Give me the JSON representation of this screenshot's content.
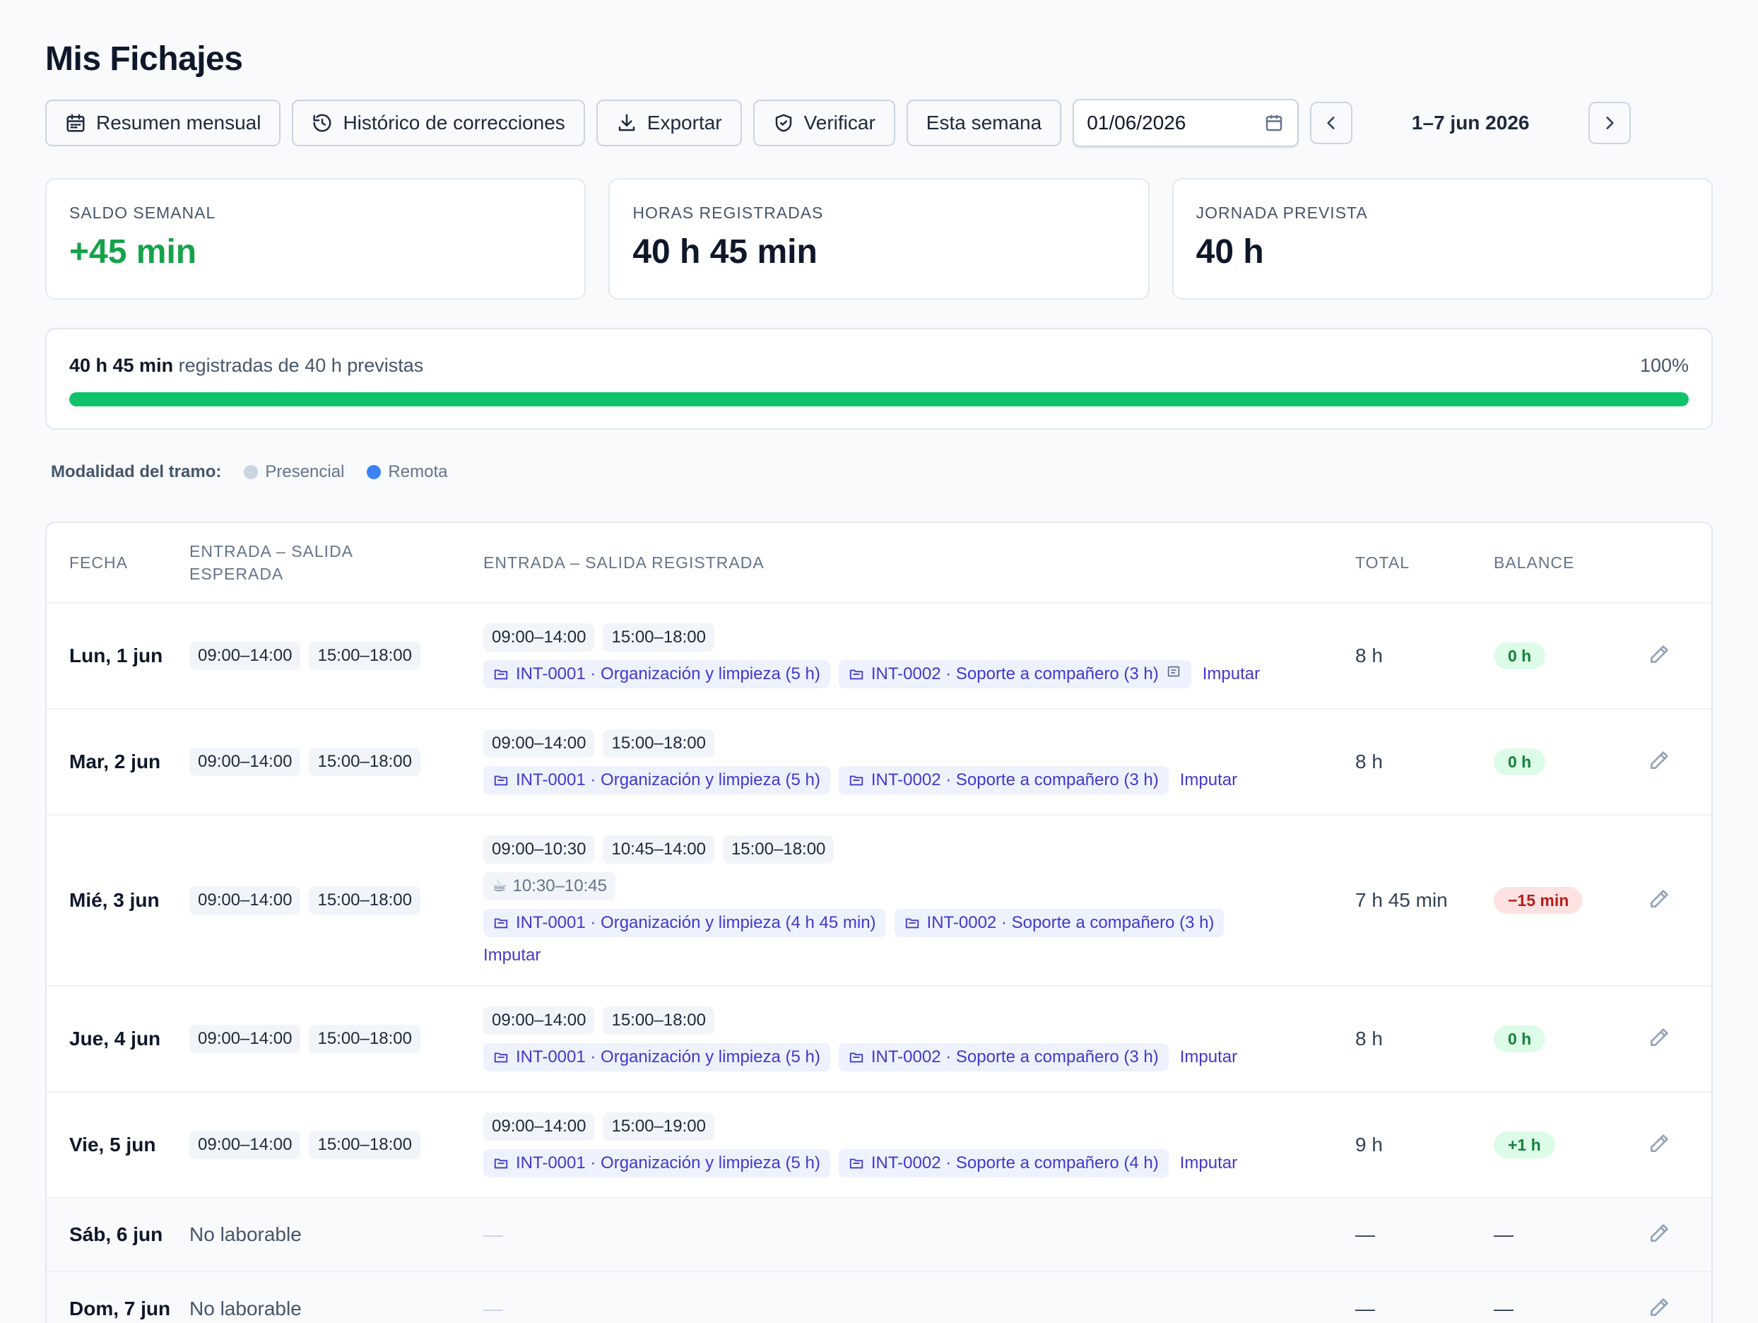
{
  "page": {
    "title": "Mis Fichajes"
  },
  "toolbar": {
    "monthly": "Resumen mensual",
    "history": "Histórico de correcciones",
    "export": "Exportar",
    "verify": "Verificar",
    "this_week": "Esta semana",
    "date_value": "01/06/2026",
    "range": "1–7 jun 2026"
  },
  "stats": [
    {
      "label": "SALDO SEMANAL",
      "value": "+45 min"
    },
    {
      "label": "HORAS REGISTRADAS",
      "value": "40 h 45 min"
    },
    {
      "label": "JORNADA PREVISTA",
      "value": "40 h"
    }
  ],
  "progress": {
    "registered": "40 h 45 min",
    "suffix": "registradas de 40 h previstas",
    "percent_label": "100%",
    "fraction": 1.0
  },
  "legend": {
    "title": "Modalidad del tramo:",
    "items": [
      {
        "label": "Presencial",
        "color": "#cbd5e1"
      },
      {
        "label": "Remota",
        "color": "#3b82f6"
      }
    ]
  },
  "table": {
    "headers": {
      "date": "FECHA",
      "expected_1": "ENTRADA – SALIDA",
      "expected_2": "ESPERADA",
      "registered": "ENTRADA – SALIDA REGISTRADA",
      "total": "TOTAL",
      "balance": "BALANCE"
    },
    "imputar": "Imputar",
    "rows": [
      {
        "date": "Lun, 1 jun",
        "expected": [
          "09:00–14:00",
          "15:00–18:00"
        ],
        "registered": [
          "09:00–14:00",
          "15:00–18:00"
        ],
        "projects": [
          "INT-0001 · Organización y limpieza (5 h)",
          "INT-0002 · Soporte a compañero (3 h)"
        ],
        "total": "8 h",
        "balance": "0 h"
      },
      {
        "date": "Mar, 2 jun",
        "expected": [
          "09:00–14:00",
          "15:00–18:00"
        ],
        "registered": [
          "09:00–14:00",
          "15:00–18:00"
        ],
        "projects": [
          "INT-0001 · Organización y limpieza (5 h)",
          "INT-0002 · Soporte a compañero (3 h)"
        ],
        "total": "8 h",
        "balance": "0 h"
      },
      {
        "date": "Mié, 3 jun",
        "expected": [
          "09:00–14:00",
          "15:00–18:00"
        ],
        "registered": [
          "09:00–10:30",
          "10:45–14:00",
          "15:00–18:00"
        ],
        "break": "10:30–10:45",
        "projects": [
          "INT-0001 · Organización y limpieza (4 h 45 min)",
          "INT-0002 · Soporte a compañero (3 h)"
        ],
        "total": "7 h 45 min",
        "balance": "−15 min"
      },
      {
        "date": "Jue, 4 jun",
        "expected": [
          "09:00–14:00",
          "15:00–18:00"
        ],
        "registered": [
          "09:00–14:00",
          "15:00–18:00"
        ],
        "projects": [
          "INT-0001 · Organización y limpieza (5 h)",
          "INT-0002 · Soporte a compañero (3 h)"
        ],
        "total": "8 h",
        "balance": "0 h"
      },
      {
        "date": "Vie, 5 jun",
        "expected": [
          "09:00–14:00",
          "15:00–18:00"
        ],
        "registered": [
          "09:00–14:00",
          "15:00–19:00"
        ],
        "projects": [
          "INT-0001 · Organización y limpieza (5 h)",
          "INT-0002 · Soporte a compañero (4 h)"
        ],
        "total": "9 h",
        "balance": "+1 h"
      },
      {
        "date": "Sáb, 6 jun",
        "expected_text": "No laborable",
        "registered_text": "—",
        "total": "—",
        "balance": "—"
      },
      {
        "date": "Dom, 7 jun",
        "expected_text": "No laborable",
        "registered_text": "—",
        "total": "—",
        "balance": "—"
      }
    ]
  },
  "icons": {
    "monthly": "calendar-icon",
    "history": "history-icon",
    "export": "download-icon",
    "verify": "shield-check-icon",
    "date": "calendar-icon",
    "prev": "chevron-left-icon",
    "next": "chevron-right-icon",
    "project": "folder-icon",
    "note": "comment-icon",
    "break": "coffee-icon",
    "edit": "pencil-icon"
  },
  "colors": {
    "positive": "#16a34a",
    "negative": "#b91c1c",
    "accent": "#4338ca",
    "progress": "#10c36a"
  }
}
